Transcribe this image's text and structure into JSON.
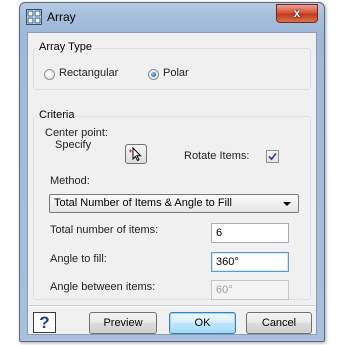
{
  "window": {
    "title": "Array",
    "close_symbol": "x"
  },
  "array_type": {
    "label": "Array Type",
    "options": [
      "Rectangular",
      "Polar"
    ],
    "selected": "Polar"
  },
  "criteria": {
    "label": "Criteria",
    "center_point_label": "Center point:",
    "specify_label": "Specify",
    "rotate_items_label": "Rotate Items:",
    "rotate_items_checked": true,
    "method_label": "Method:",
    "method_value": "Total Number of Items & Angle to Fill",
    "total_items_label": "Total number of items:",
    "total_items_value": "6",
    "angle_fill_label": "Angle to fill:",
    "angle_fill_value": "360°",
    "angle_between_label": "Angle between items:",
    "angle_between_value": "60°"
  },
  "buttons": {
    "help": "?",
    "preview": "Preview",
    "ok": "OK",
    "cancel": "Cancel"
  },
  "icons": {
    "app": "array-grid-icon",
    "pick": "cursor-pick-icon",
    "check": "checkmark-icon"
  }
}
